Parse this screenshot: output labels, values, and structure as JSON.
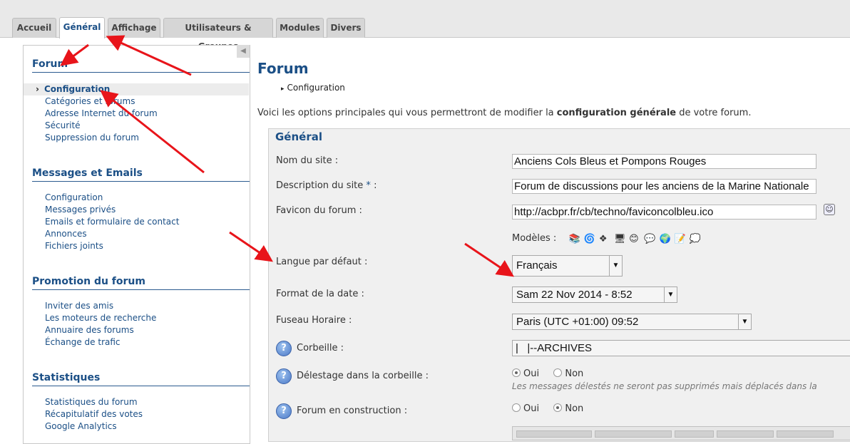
{
  "tabs": [
    "Accueil",
    "Général",
    "Affichage",
    "Utilisateurs & Groupes",
    "Modules",
    "Divers"
  ],
  "sidebar": {
    "collapse_glyph": "◀",
    "sections": [
      {
        "title": "Forum",
        "items": [
          "Configuration",
          "Catégories et forums",
          "Adresse Internet du forum",
          "Sécurité",
          "Suppression du forum"
        ]
      },
      {
        "title": "Messages et Emails",
        "items": [
          "Configuration",
          "Messages privés",
          "Emails et formulaire de contact",
          "Annonces",
          "Fichiers joints"
        ]
      },
      {
        "title": "Promotion du forum",
        "items": [
          "Inviter des amis",
          "Les moteurs de recherche",
          "Annuaire des forums",
          "Échange de trafic"
        ]
      },
      {
        "title": "Statistiques",
        "items": [
          "Statistiques du forum",
          "Récapitulatif des votes",
          "Google Analytics"
        ]
      }
    ]
  },
  "main": {
    "title": "Forum",
    "breadcrumb": "Configuration",
    "intro_before": "Voici les options principales qui vous permettront de modifier la ",
    "intro_bold": "configuration générale",
    "intro_after": " de votre forum.",
    "panel_title": "Général",
    "fields": {
      "site_name_label": "Nom du site :",
      "site_name_value": "Anciens Cols Bleus et Pompons Rouges",
      "site_desc_label": "Description du site",
      "site_desc_star": "*",
      "site_desc_colon": ":",
      "site_desc_value": "Forum de discussions pour les anciens de la Marine Nationale",
      "favicon_label": "Favicon du forum :",
      "favicon_value": "http://acbpr.fr/cb/techno/faviconcolbleu.ico",
      "modeles_label": "Modèles :",
      "modeles_icons": [
        "📚",
        "🌀",
        "❖",
        "🖥",
        "😊",
        "💬",
        "🌍",
        "📝",
        "💭"
      ],
      "langue_label": "Langue par défaut :",
      "langue_value": "Français",
      "date_label": "Format de la date :",
      "date_value": "Sam 22 Nov 2014 - 8:52",
      "tz_label": "Fuseau Horaire :",
      "tz_value": "Paris (UTC +01:00) 09:52",
      "corbeille_label": "Corbeille :",
      "corbeille_value": "|   |--ARCHIVES",
      "delestage_label": "Délestage dans la corbeille :",
      "delestage_hint": "Les messages délestés ne seront pas supprimés mais déplacés dans la",
      "construction_label": "Forum en construction :",
      "oui": "Oui",
      "non": "Non"
    }
  },
  "colors": {
    "accent": "#1b4f86",
    "arrow": "#e8141a"
  }
}
